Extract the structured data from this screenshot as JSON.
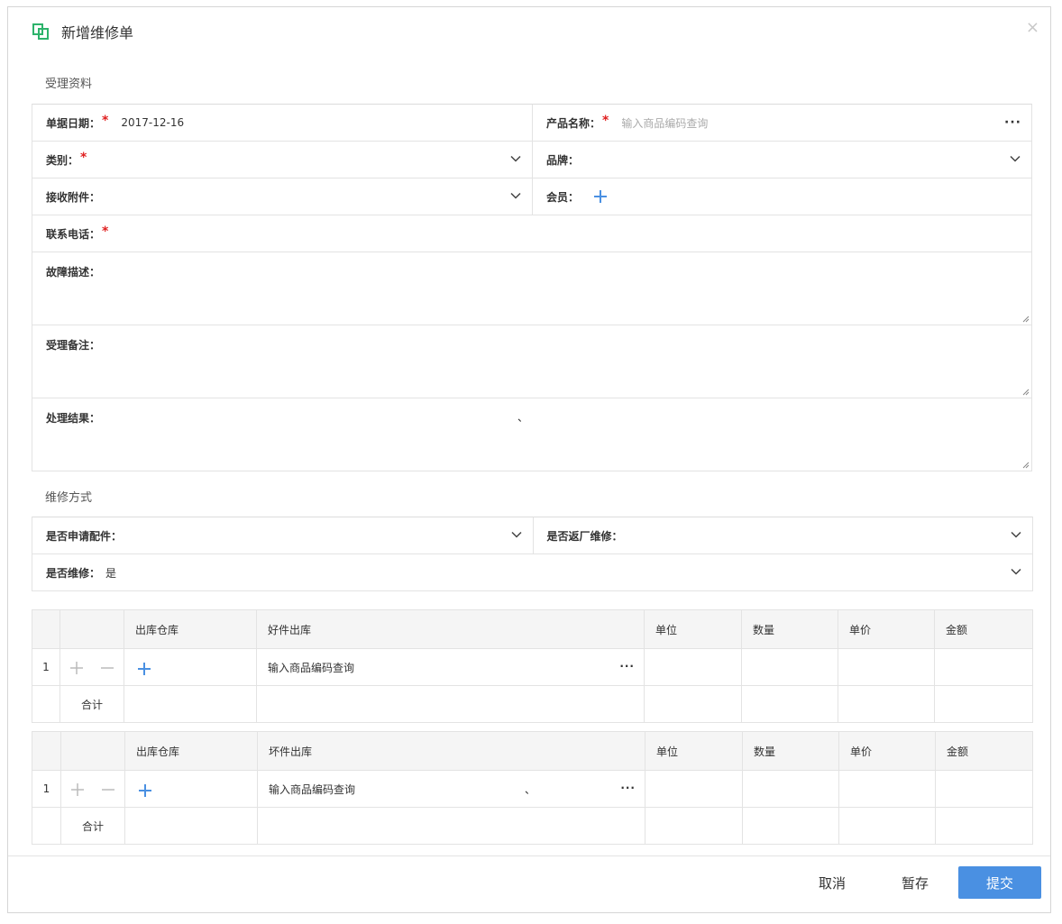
{
  "dialog": {
    "title": "新增维修单",
    "close_label": "×"
  },
  "accept_section": {
    "title": "受理资料",
    "doc_date_label": "单据日期：",
    "doc_date_value": "2017-12-16",
    "product_label": "产品名称：",
    "product_placeholder": "输入商品编码查询",
    "more_label": "···",
    "category_label": "类别：",
    "brand_label": "品牌：",
    "attachment_label": "接收附件：",
    "member_label": "会员：",
    "phone_label": "联系电话：",
    "fault_label": "故障描述：",
    "remark_label": "受理备注：",
    "result_label": "处理结果：",
    "required_mark": "*",
    "stray_mark": "、"
  },
  "repair_section": {
    "title": "维修方式",
    "apply_parts_label": "是否申请配件：",
    "return_factory_label": "是否返厂维修：",
    "repair_label": "是否维修：",
    "repair_value": "是"
  },
  "good_table": {
    "headers": [
      "",
      "",
      "出库仓库",
      "好件出库",
      "单位",
      "数量",
      "单价",
      "金额"
    ],
    "row_index": "1",
    "add_label": "+",
    "remove_label": "—",
    "placeholder": "输入商品编码查询",
    "more_label": "···",
    "total_label": "合计"
  },
  "bad_table": {
    "headers": [
      "",
      "",
      "出库仓库",
      "坏件出库",
      "单位",
      "数量",
      "单价",
      "金额"
    ],
    "row_index": "1",
    "add_label": "+",
    "remove_label": "—",
    "placeholder": "输入商品编码查询",
    "more_label": "···",
    "total_label": "合计",
    "stray_mark": "、"
  },
  "footer": {
    "cancel_label": "取消",
    "save_label": "暂存",
    "submit_label": "提交"
  },
  "colors": {
    "accent": "#4a90e2",
    "icon_green": "#2db36b",
    "required": "#e02020"
  }
}
